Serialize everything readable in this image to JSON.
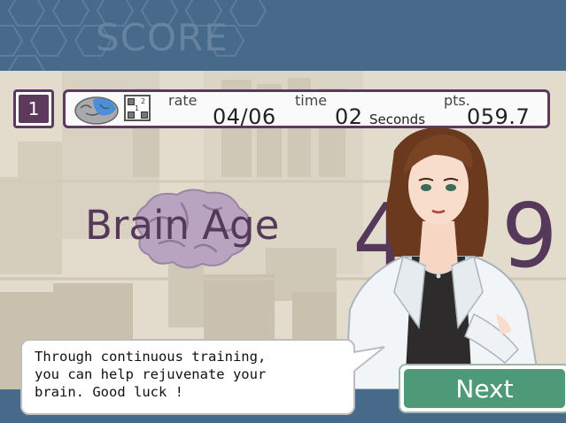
{
  "header": {
    "title": "SCORE"
  },
  "result": {
    "rank": "1",
    "rate_label": "rate",
    "rate_value": "04/06",
    "time_label": "time",
    "time_value": "02",
    "time_unit": "Seconds",
    "pts_label": "pts.",
    "pts_value": "059.7",
    "grid_digits": [
      "2",
      "1"
    ]
  },
  "brain_age": {
    "label": "Brain Age",
    "digits": [
      "4",
      "9"
    ]
  },
  "dialog": {
    "lines": [
      "Through continuous training,",
      "you can help rejuvenate your",
      "brain. Good luck !"
    ]
  },
  "buttons": {
    "next": "Next"
  },
  "colors": {
    "header_blue": "#47698a",
    "accent_purple": "#55385a",
    "button_green": "#4e9a78"
  }
}
